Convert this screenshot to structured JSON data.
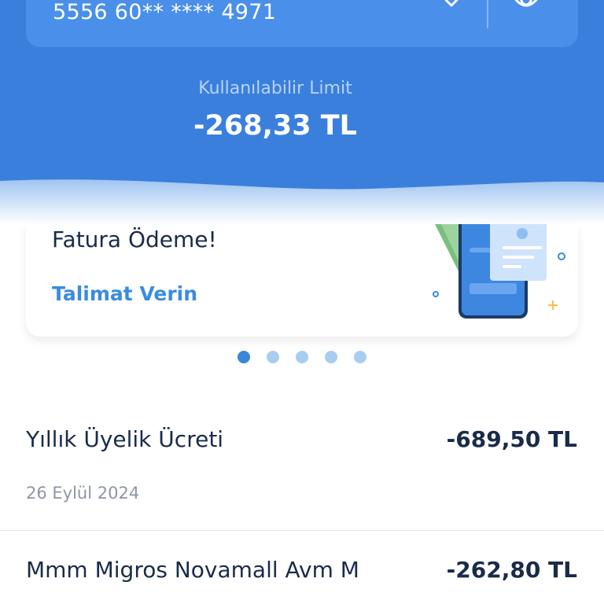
{
  "card": {
    "number": "5556 60** **** 4971"
  },
  "limit": {
    "label": "Kullanılabilir Limit",
    "value": "-268,33 TL"
  },
  "banner": {
    "title": "Fatura Ödeme!",
    "link": "Talimat Verin",
    "carousel_total": 5,
    "carousel_active": 1
  },
  "transactions": [
    {
      "title": "Yıllık Üyelik Ücreti",
      "amount": "-689,50 TL",
      "date": "26 Eylül 2024"
    },
    {
      "title": "Mmm Migros Novamall Avm M",
      "amount": "-262,80 TL"
    }
  ],
  "colors": {
    "header_blue": "#3a7fdc",
    "link_blue": "#3a8ce0",
    "text_dark": "#1a2b4a"
  }
}
